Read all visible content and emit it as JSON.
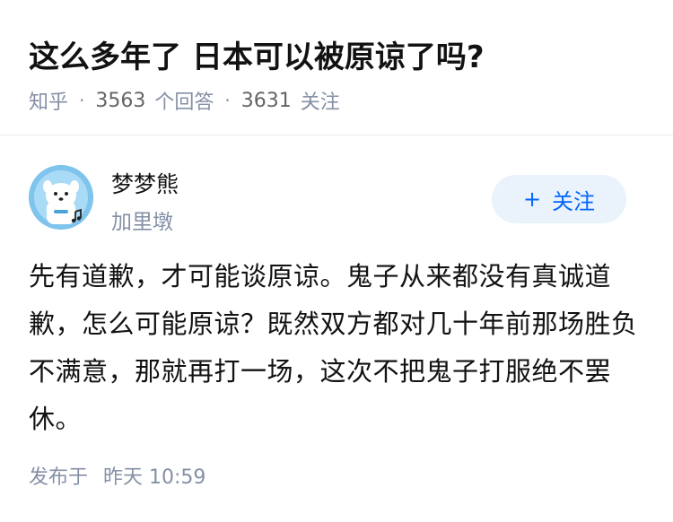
{
  "question": {
    "title": "这么多年了 日本可以被原谅了吗?",
    "source": "知乎",
    "answer_count": "3563",
    "answer_label": "个回答",
    "follower_count": "3631",
    "follower_label": "关注",
    "separator": "·"
  },
  "author": {
    "name": "梦梦熊",
    "headline": "加里墩",
    "avatar_icon": "cartoon-bear-avatar-icon"
  },
  "follow_button": {
    "icon": "plus-icon",
    "plus": "+",
    "label": "关注"
  },
  "answer": {
    "content": "先有道歉，才可能谈原谅。鬼子从来都没有真诚道歉，怎么可能原谅？既然双方都对几十年前那场胜负不满意，那就再打一场，这次不把鬼子打服绝不罢休。",
    "published_prefix": "发布于",
    "published_time": "昨天 10:59"
  },
  "colors": {
    "accent": "#0066ff",
    "follow_bg": "#eaf2fb",
    "meta_gray": "#8590a6",
    "avatar_bg": "#7fc4ec"
  }
}
